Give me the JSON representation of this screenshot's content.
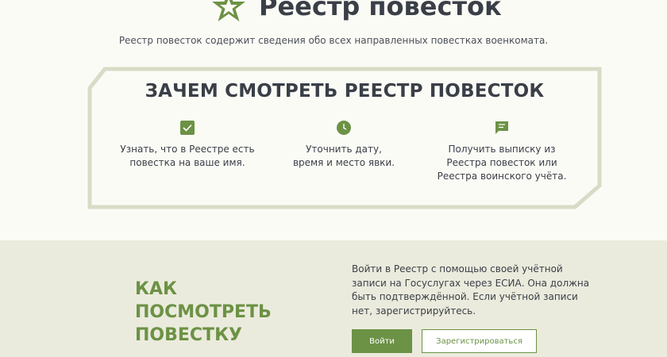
{
  "header": {
    "title": "Реестр повесток",
    "subtitle": "Реестр повесток содержит сведения обо всех направленных повестках военкомата."
  },
  "why": {
    "title": "ЗАЧЕМ СМОТРЕТЬ РЕЕСТР ПОВЕСТОК",
    "items": [
      {
        "icon": "check-square-icon",
        "text": "Узнать, что в Реестре есть\nповестка на ваше имя."
      },
      {
        "icon": "clock-icon",
        "text": "Уточнить дату,\nвремя и место явки."
      },
      {
        "icon": "message-icon",
        "text": "Получить выписку из\nРеестра повесток или\nРеестра воинского учёта."
      }
    ]
  },
  "how": {
    "title": "КАК\nПОСМОТРЕТЬ\nПОВЕСТКУ",
    "text": "Войти в Реестр с помощью своей учётной записи на Госуслугах через ЕСИА. Она должна быть подтверждённой. Если учётной записи нет, зарегистрируйтесь.",
    "login_label": "Войти",
    "register_label": "Зарегистрироваться"
  },
  "colors": {
    "accent": "#6c9245",
    "frame": "#d8dcc6",
    "lower_bg": "#ebebdd",
    "page_bg": "#fbfbf6",
    "text": "#3a3f47"
  }
}
